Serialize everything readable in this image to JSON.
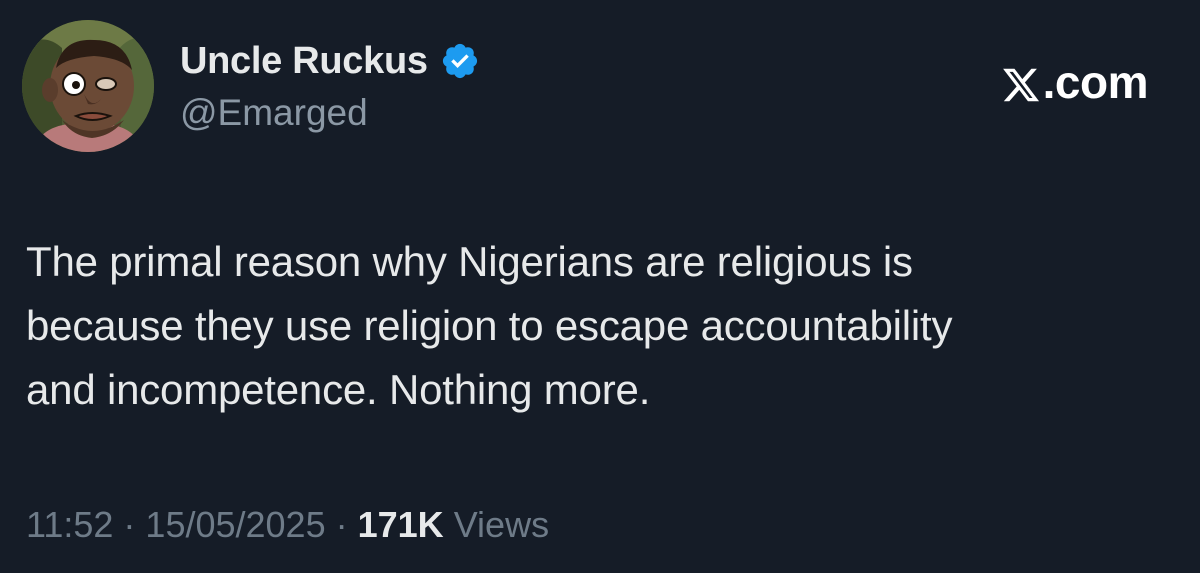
{
  "author": {
    "display_name": "Uncle Ruckus",
    "handle": "@Emarged",
    "verified": true
  },
  "brand": {
    "label": ".com",
    "icon": "x-logo-icon"
  },
  "tweet": {
    "lines": [
      "The primal reason why Nigerians are religious is",
      "because they use religion to escape accountability",
      "and incompetence. Nothing more."
    ]
  },
  "meta": {
    "time": "11:52",
    "separator": " · ",
    "date": "15/05/2025",
    "views_count": "171K",
    "views_label": "Views"
  },
  "colors": {
    "background": "#151c27",
    "verified_badge": "#1d9bf0",
    "secondary_text": "#8b98a5"
  }
}
